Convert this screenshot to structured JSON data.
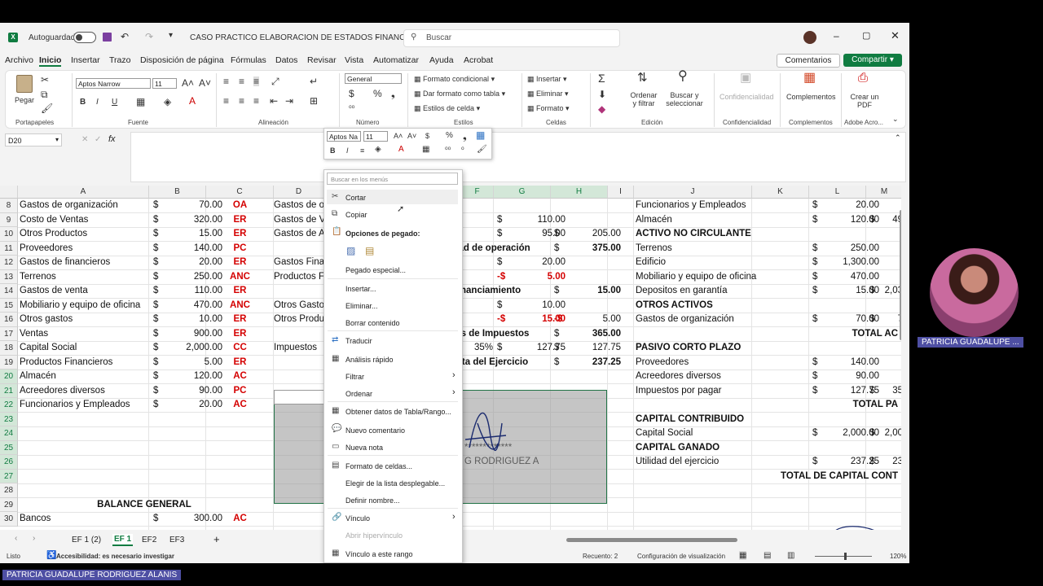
{
  "titlebar": {
    "autosave_label": "Autoguardado",
    "doc_title": "CASO PRACTICO ELABORACION DE ESTADOS FINANCIE...",
    "search_placeholder": "Buscar"
  },
  "menu": [
    "Archivo",
    "Inicio",
    "Insertar",
    "Trazo",
    "Disposición de página",
    "Fórmulas",
    "Datos",
    "Revisar",
    "Vista",
    "Automatizar",
    "Ayuda",
    "Acrobat"
  ],
  "menu_right": {
    "comments": "Comentarios",
    "share": "Compartir"
  },
  "ribbon": {
    "paste": "Pegar",
    "font_name": "Aptos Narrow",
    "font_size": "11",
    "number_format": "General",
    "cond_format": "Formato condicional",
    "table_format": "Dar formato como tabla",
    "cell_styles": "Estilos de celda",
    "insert": "Insertar",
    "delete": "Eliminar",
    "format": "Formato",
    "sort_filter": "Ordenar y filtrar",
    "find_select": "Buscar y seleccionar",
    "confidentiality": "Confidencialidad",
    "addins": "Complementos",
    "create_pdf": "Crear un PDF",
    "groups": {
      "clipboard": "Portapapeles",
      "font": "Fuente",
      "alignment": "Alineación",
      "number": "Número",
      "styles": "Estilos",
      "cells": "Celdas",
      "editing": "Edición",
      "confidentiality": "Confidencialidad",
      "addins": "Complementos",
      "adobe": "Adobe Acro..."
    }
  },
  "namebox": "D20",
  "columns": [
    "A",
    "B",
    "C",
    "D",
    "E",
    "F",
    "G",
    "H",
    "I",
    "J",
    "K",
    "L",
    "M"
  ],
  "rows": [
    {
      "n": "8",
      "a": "Gastos de organización",
      "b": "70.00",
      "c": "OA",
      "d": "Gastos de o",
      "j": "Funcionarios y Empleados",
      "l": "20.00"
    },
    {
      "n": "9",
      "a": "Costo de Ventas",
      "b": "320.00",
      "c": "ER",
      "d": "Gastos de V",
      "g": "110.00",
      "j": "Almacén",
      "l": "120.00",
      "m": "49"
    },
    {
      "n": "10",
      "a": "Otros Productos",
      "b": "15.00",
      "c": "ER",
      "d": "Gastos de A",
      "g": "95.00",
      "h": "205.00",
      "j": "ACTIVO NO CIRCULANTE"
    },
    {
      "n": "11",
      "a": "Proveedores",
      "b": "140.00",
      "c": "PC",
      "f": "tilidad de operación",
      "h": "375.00",
      "j": "Terrenos",
      "l": "250.00"
    },
    {
      "n": "12",
      "a": "Gastos de financieros",
      "b": "20.00",
      "c": "ER",
      "d": "Gastos Fina",
      "g": "20.00",
      "j": "Edificio",
      "l": "1,300.00"
    },
    {
      "n": "13",
      "a": "Terrenos",
      "b": "250.00",
      "c": "ANC",
      "d": "Productos F",
      "g": "5.00",
      "j": "Mobiliario y equipo de oficina",
      "l": "470.00"
    },
    {
      "n": "14",
      "a": "Gastos de venta",
      "b": "110.00",
      "c": "ER",
      "f": "el Financiamiento",
      "h": "15.00",
      "j": "Depositos en garantía",
      "l": "15.00",
      "m": "2,03"
    },
    {
      "n": "15",
      "a": "Mobiliario y equipo de oficina",
      "b": "470.00",
      "c": "ANC",
      "d": "Otros Gasto",
      "g": "10.00",
      "j": "OTROS ACTIVOS"
    },
    {
      "n": "16",
      "a": "Otros gastos",
      "b": "10.00",
      "c": "ER",
      "d": "Otros Produ",
      "g": "15.00",
      "h": "5.00",
      "j": "Gastos de organización",
      "l": "70.00",
      "m": "7"
    },
    {
      "n": "17",
      "a": "Ventas",
      "b": "900.00",
      "c": "ER",
      "f": "antes de Impuestos",
      "h": "365.00",
      "l": "TOTAL AC"
    },
    {
      "n": "18",
      "a": "Capital Social",
      "b": "2,000.00",
      "c": "CC",
      "d": "Impuestos",
      "f": "35%",
      "g": "127.75",
      "h": "127.75",
      "j": "PASIVO CORTO PLAZO"
    },
    {
      "n": "19",
      "a": "Productos Financieros",
      "b": "5.00",
      "c": "ER",
      "f": "d Neta del Ejercicio",
      "h": "237.25",
      "j": "Proveedores",
      "l": "140.00"
    },
    {
      "n": "20",
      "a": "Almacén",
      "b": "120.00",
      "c": "AC",
      "j": "Acreedores diversos",
      "l": "90.00"
    },
    {
      "n": "21",
      "a": "Acreedores diversos",
      "b": "90.00",
      "c": "PC",
      "j": "Impuestos por pagar",
      "l": "127.75",
      "m": "35"
    },
    {
      "n": "22",
      "a": "Funcionarios y Empleados",
      "b": "20.00",
      "c": "AC",
      "l": "TOTAL PA"
    },
    {
      "n": "23",
      "j": "CAPITAL CONTRIBUIDO"
    },
    {
      "n": "24",
      "j": "Capital Social",
      "l": "2,000.00",
      "m": "2,00"
    },
    {
      "n": "25",
      "f": "*************",
      "j": "CAPITAL GANADO"
    },
    {
      "n": "26",
      "f": "G RODRIGUEZ A",
      "j": "Utilidad del ejercicio",
      "l": "237.25",
      "m": "23"
    },
    {
      "n": "27",
      "k": "TOTAL DE CAPITAL CONT"
    },
    {
      "n": "28"
    },
    {
      "n": "29",
      "a": "BALANCE GENERAL"
    },
    {
      "n": "30",
      "a": "Bancos",
      "b": "300.00",
      "c": "AC"
    }
  ],
  "context_menu": {
    "search_placeholder": "Buscar en los menús",
    "items": [
      "Cortar",
      "Copiar",
      "Opciones de pegado:",
      "Pegado especial...",
      "Insertar...",
      "Eliminar...",
      "Borrar contenido",
      "Traducir",
      "Análisis rápido",
      "Filtrar",
      "Ordenar",
      "Obtener datos de Tabla/Rango...",
      "Nuevo comentario",
      "Nueva nota",
      "Formato de celdas...",
      "Elegir de la lista desplegable...",
      "Definir nombre...",
      "Vínculo",
      "Abrir hipervínculo",
      "Vínculo a este rango"
    ]
  },
  "mini_toolbar": {
    "font": "Aptos Na",
    "size": "11"
  },
  "sheet_tabs": [
    "EF 1 (2)",
    "EF 1",
    "EF2",
    "EF3"
  ],
  "status": {
    "ready": "Listo",
    "accessibility": "Accesibilidad: es necesario investigar",
    "count": "Recuento: 2",
    "display": "Configuración de visualización",
    "zoom": "120%"
  },
  "participant": {
    "short": "PATRICIA GUADALUPE ...",
    "full": "PATRICIA GUADALUPE RODRIGUEZ ALANIS"
  },
  "colors": {
    "excel_green": "#107c41",
    "red": "#d40000",
    "badge": "#4e4fa3"
  }
}
